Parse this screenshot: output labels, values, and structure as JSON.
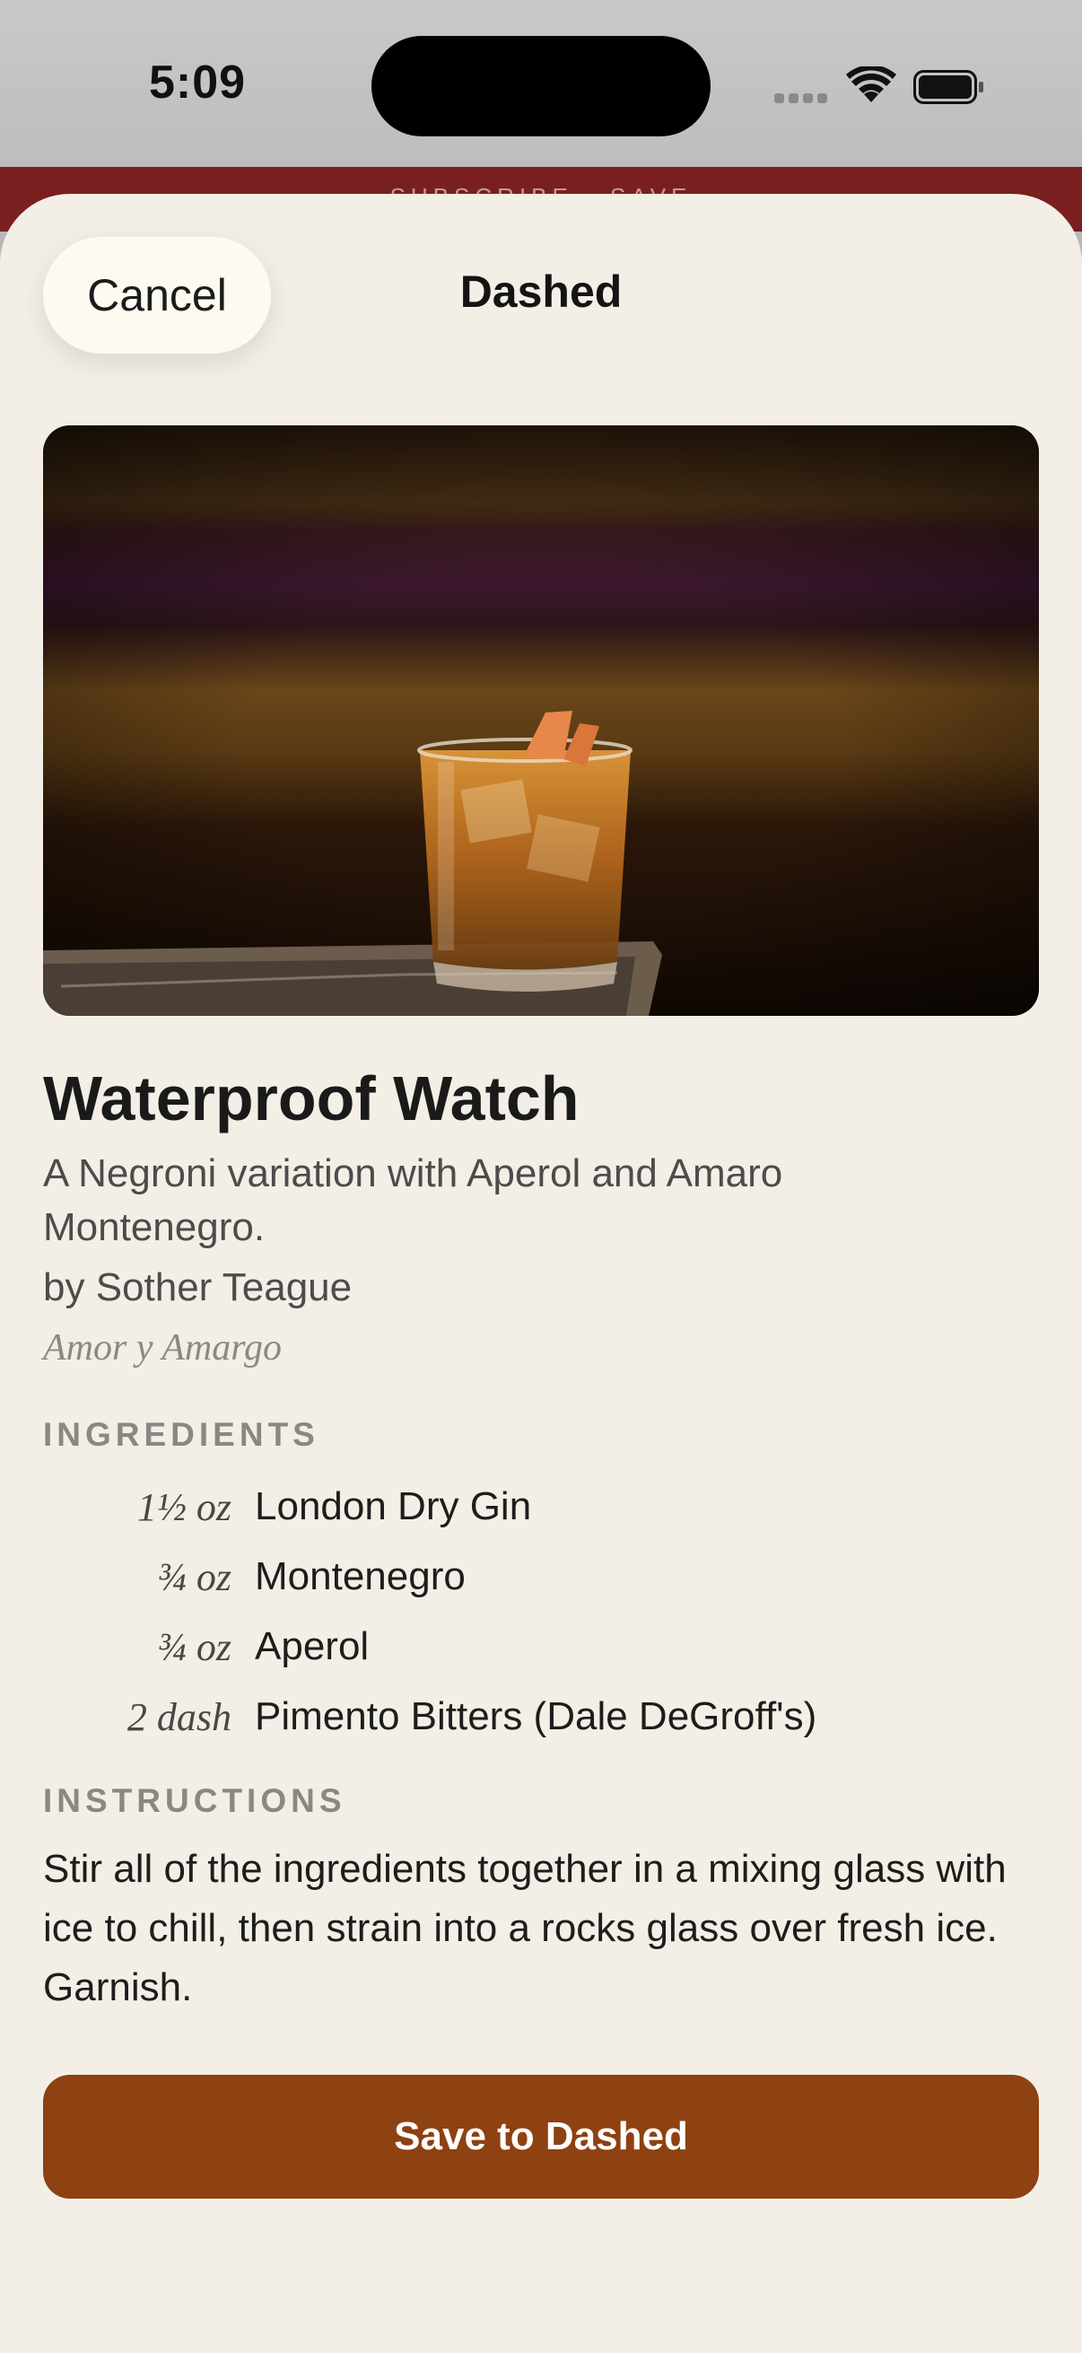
{
  "status_bar": {
    "time": "5:09"
  },
  "underlying": {
    "header_text": "SUBSCRIBE · SAVE"
  },
  "sheet": {
    "cancel_label": "Cancel",
    "title": "Dashed"
  },
  "recipe": {
    "name": "Waterproof Watch",
    "description": "A Negroni variation with Aperol and Amaro Montenegro.",
    "byline": "by Sother Teague",
    "source": "Amor y Amargo",
    "ingredients_label": "INGREDIENTS",
    "ingredients": [
      {
        "qty": "1½ oz",
        "name": "London Dry Gin"
      },
      {
        "qty": "¾ oz",
        "name": "Montenegro"
      },
      {
        "qty": "¾ oz",
        "name": "Aperol"
      },
      {
        "qty": "2 dash",
        "name": "Pimento Bitters (Dale DeGroff's)"
      }
    ],
    "instructions_label": "INSTRUCTIONS",
    "instructions": "Stir all of the ingredients together in a mixing glass with ice to chill, then strain into a rocks glass over fresh ice. Garnish."
  },
  "actions": {
    "save_label": "Save to Dashed"
  },
  "colors": {
    "sheet_background": "#f3efe6",
    "save_button": "#8e4111",
    "underlying_header": "#7a1f1f"
  },
  "icons": [
    "signal-icon",
    "wifi-icon",
    "battery-icon"
  ]
}
